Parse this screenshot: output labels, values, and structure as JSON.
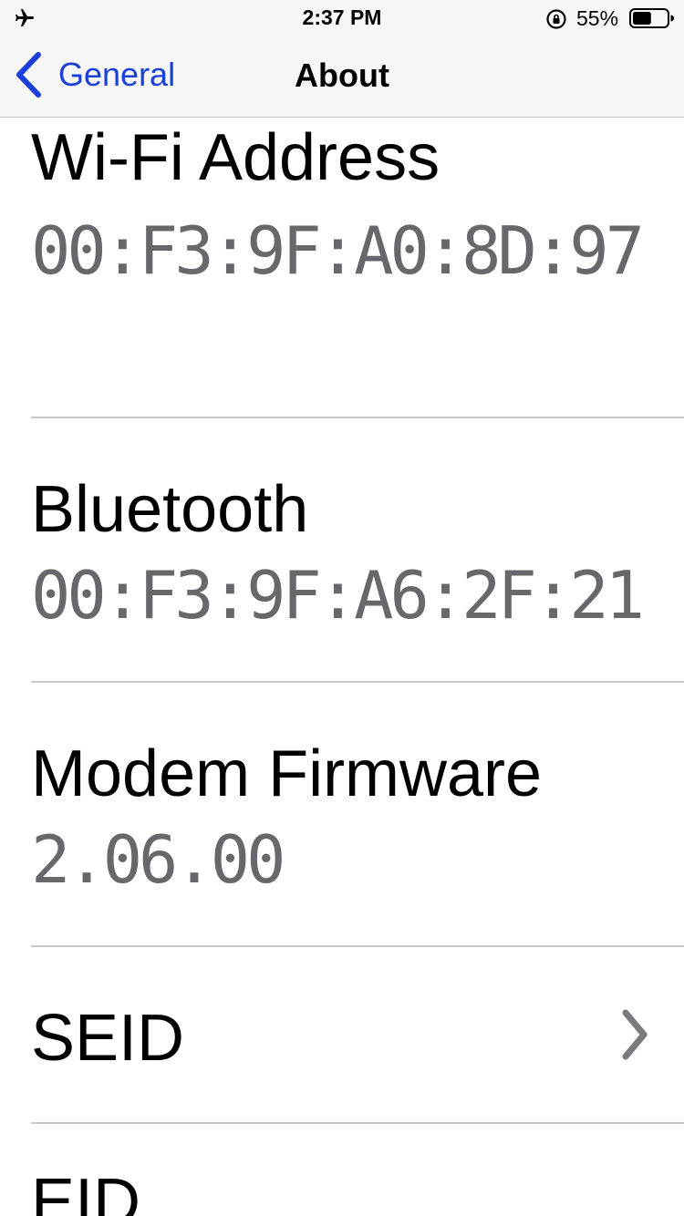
{
  "status_bar": {
    "time": "2:37 PM",
    "battery_percent": "55%",
    "battery_level": 0.55,
    "icons": [
      "airplane-icon",
      "orientation-lock-icon",
      "battery-icon"
    ]
  },
  "nav": {
    "back_label": "General",
    "title": "About"
  },
  "rows": [
    {
      "label": "Wi-Fi Address",
      "value": "00:F3:9F:A0:8D:97"
    },
    {
      "label": "Bluetooth",
      "value": "00:F3:9F:A6:2F:21"
    },
    {
      "label": "Modem Firmware",
      "value": "2.06.00"
    },
    {
      "label": "SEID",
      "value": ""
    },
    {
      "label": "EID",
      "value": ""
    }
  ],
  "colors": {
    "accent": "#1a40d9",
    "value_gray": "#67676c",
    "separator": "#c8c7cc",
    "bar_bg": "#f7f7f7"
  }
}
